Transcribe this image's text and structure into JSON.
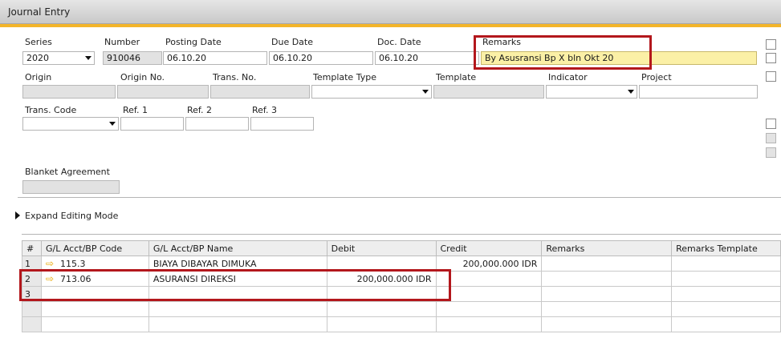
{
  "window": {
    "title": "Journal Entry"
  },
  "header": {
    "series": {
      "label": "Series",
      "value": "2020"
    },
    "number": {
      "label": "Number",
      "value": "910046"
    },
    "posting_date": {
      "label": "Posting Date",
      "value": "06.10.20"
    },
    "due_date": {
      "label": "Due Date",
      "value": "06.10.20"
    },
    "doc_date": {
      "label": "Doc. Date",
      "value": "06.10.20"
    },
    "remarks": {
      "label": "Remarks",
      "value": "By Asusransi Bp X bln Okt 20"
    },
    "origin": {
      "label": "Origin",
      "value": ""
    },
    "origin_no": {
      "label": "Origin No.",
      "value": ""
    },
    "trans_no": {
      "label": "Trans. No.",
      "value": ""
    },
    "template_type": {
      "label": "Template Type",
      "value": ""
    },
    "template": {
      "label": "Template",
      "value": ""
    },
    "indicator": {
      "label": "Indicator",
      "value": ""
    },
    "project": {
      "label": "Project",
      "value": ""
    },
    "trans_code": {
      "label": "Trans. Code",
      "value": ""
    },
    "ref1": {
      "label": "Ref. 1",
      "value": ""
    },
    "ref2": {
      "label": "Ref. 2",
      "value": ""
    },
    "ref3": {
      "label": "Ref. 3",
      "value": ""
    },
    "blanket_agreement": {
      "label": "Blanket Agreement",
      "value": ""
    }
  },
  "expand_editing_mode": "Expand Editing Mode",
  "grid": {
    "columns": [
      "#",
      "G/L Acct/BP Code",
      "G/L Acct/BP Name",
      "Debit",
      "Credit",
      "Remarks",
      "Remarks Template"
    ],
    "rows": [
      {
        "num": "1",
        "code": "115.3",
        "name": "BIAYA DIBAYAR DIMUKA",
        "debit": "",
        "credit": "200,000.000 IDR",
        "remarks": "",
        "template": ""
      },
      {
        "num": "2",
        "code": "713.06",
        "name": "ASURANSI DIREKSI",
        "debit": "200,000.000 IDR",
        "credit": "",
        "remarks": "",
        "template": ""
      },
      {
        "num": "3",
        "code": "",
        "name": "",
        "debit": "",
        "credit": "",
        "remarks": "",
        "template": ""
      },
      {
        "num": "",
        "code": "",
        "name": "",
        "debit": "",
        "credit": "",
        "remarks": "",
        "template": ""
      },
      {
        "num": "",
        "code": "",
        "name": "",
        "debit": "",
        "credit": "",
        "remarks": "",
        "template": ""
      },
      {
        "num": "",
        "code": "",
        "name": "",
        "debit": "",
        "credit": "",
        "remarks": "",
        "template": ""
      }
    ]
  },
  "icons": {
    "row_link": "link-arrow-icon",
    "dropdown": "dropdown-arrow-icon"
  },
  "colors": {
    "accent": "#f3b52a",
    "highlight_box": "#b3171c",
    "remarks_field": "#fbf0a6",
    "link_arrow": "#e9a800"
  }
}
